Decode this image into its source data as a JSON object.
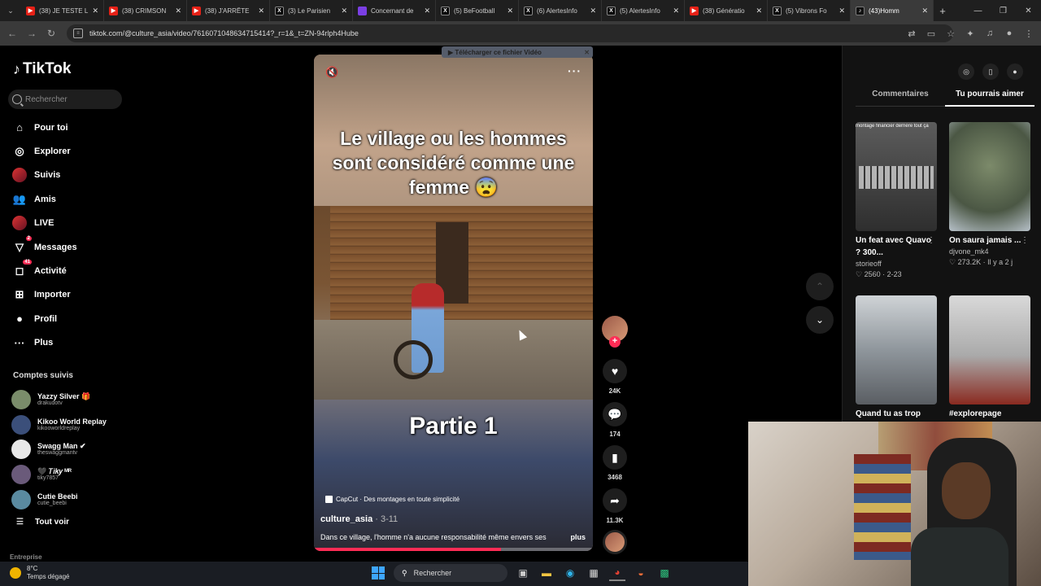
{
  "browser": {
    "tabs": [
      {
        "label": "(38) JE TESTE L",
        "icon": "youtube-icon",
        "kind": "yt"
      },
      {
        "label": "(38) CRIMSON",
        "icon": "youtube-icon",
        "kind": "yt"
      },
      {
        "label": "(38) J'ARRÊTE",
        "icon": "youtube-icon",
        "kind": "yt"
      },
      {
        "label": "(3) Le Parisien",
        "icon": "x-icon",
        "kind": "x"
      },
      {
        "label": "Concernant de",
        "icon": "twitch-icon",
        "kind": "pp"
      },
      {
        "label": "(5) BeFootball",
        "icon": "x-icon",
        "kind": "x"
      },
      {
        "label": "(6) AlertesInfo",
        "icon": "x-icon",
        "kind": "x"
      },
      {
        "label": "(5) AlertesInfo",
        "icon": "x-icon",
        "kind": "x"
      },
      {
        "label": "(38) Génératio",
        "icon": "youtube-icon",
        "kind": "yt"
      },
      {
        "label": "(5) Vibrons Fo",
        "icon": "x-icon",
        "kind": "x"
      },
      {
        "label": "(43)Homm",
        "icon": "tiktok-icon",
        "kind": "tt",
        "active": true
      }
    ],
    "url": "tiktok.com/@culture_asia/video/7616071048634715414?_r=1&_t=ZN-94rlph4Hube"
  },
  "sidebar": {
    "logo": "TikTok",
    "search_placeholder": "Rechercher",
    "nav": [
      {
        "label": "Pour toi",
        "icon": "home-icon",
        "glyph": "⌂"
      },
      {
        "label": "Explorer",
        "icon": "compass-icon",
        "glyph": "◎"
      },
      {
        "label": "Suivis",
        "icon": "avatar-icon",
        "glyph": ""
      },
      {
        "label": "Amis",
        "icon": "friends-icon",
        "glyph": "👥"
      },
      {
        "label": "LIVE",
        "icon": "live-avatar-icon",
        "glyph": ""
      },
      {
        "label": "Messages",
        "icon": "send-icon",
        "glyph": "▽",
        "badge": "2"
      },
      {
        "label": "Activité",
        "icon": "inbox-icon",
        "glyph": "◻",
        "badge": "41"
      },
      {
        "label": "Importer",
        "icon": "upload-icon",
        "glyph": "⊞"
      },
      {
        "label": "Profil",
        "icon": "profile-icon",
        "glyph": "●"
      },
      {
        "label": "Plus",
        "icon": "more-icon",
        "glyph": "···"
      }
    ],
    "following_title": "Comptes suivis",
    "following": [
      {
        "name": "Yazzy Silver 🎁",
        "handle": "drakudotv",
        "color": "#7a8c6a"
      },
      {
        "name": "Kikoo World Replay",
        "handle": "kikooworldreplay",
        "color": "#3b4f7a"
      },
      {
        "name": "Swagg Man ✔",
        "handle": "theswaggmantv",
        "color": "#e8e8e8"
      },
      {
        "name": "🖤 𝑇𝑖𝑘𝑦 ᴹᴿ",
        "handle": "tiky7857",
        "color": "#6a5a7a"
      },
      {
        "name": "Cutie Beebi",
        "handle": "cutie_beebi",
        "color": "#5a8aa0"
      }
    ],
    "see_all": "Tout voir",
    "bottom": "Entreprise"
  },
  "video": {
    "caption_top": "Le village ou les hommes sont considéré comme une femme 😨",
    "caption_bottom": "Partie 1",
    "capcut": "CapCut · Des montages en toute simplicité",
    "author": "culture_asia",
    "date": " · 3-11",
    "description": "Dans ce village, l'homme n'a aucune responsabilité même envers ses",
    "more": "plus",
    "progress": 0.67,
    "download_overlay": "▶ Télécharger ce fichier Vidéo"
  },
  "actions": {
    "likes": "24K",
    "comments": "174",
    "saves": "3468",
    "shares": "11.3K"
  },
  "right_panel": {
    "tabs": [
      "Commentaires",
      "Tu pourrais aimer"
    ],
    "cards": [
      {
        "title": "Un feat avec Quavo ? 300...",
        "author": "storieoff",
        "meta": "♡ 2560 · 2-23",
        "thumb_text": "montage financier derrière tout ça"
      },
      {
        "title": "On saura jamais ...",
        "author": "djvone_mk4",
        "meta": "♡ 273.2K · Il y a 2 j",
        "thumb_text": ""
      },
      {
        "title": "Quand tu as trop",
        "author": "",
        "meta": "",
        "thumb_text": ""
      },
      {
        "title": "#explorepage",
        "author": "",
        "meta": "",
        "thumb_text": ""
      }
    ]
  },
  "taskbar": {
    "temp": "8°C",
    "weather": "Temps dégagé",
    "search": "Rechercher"
  }
}
